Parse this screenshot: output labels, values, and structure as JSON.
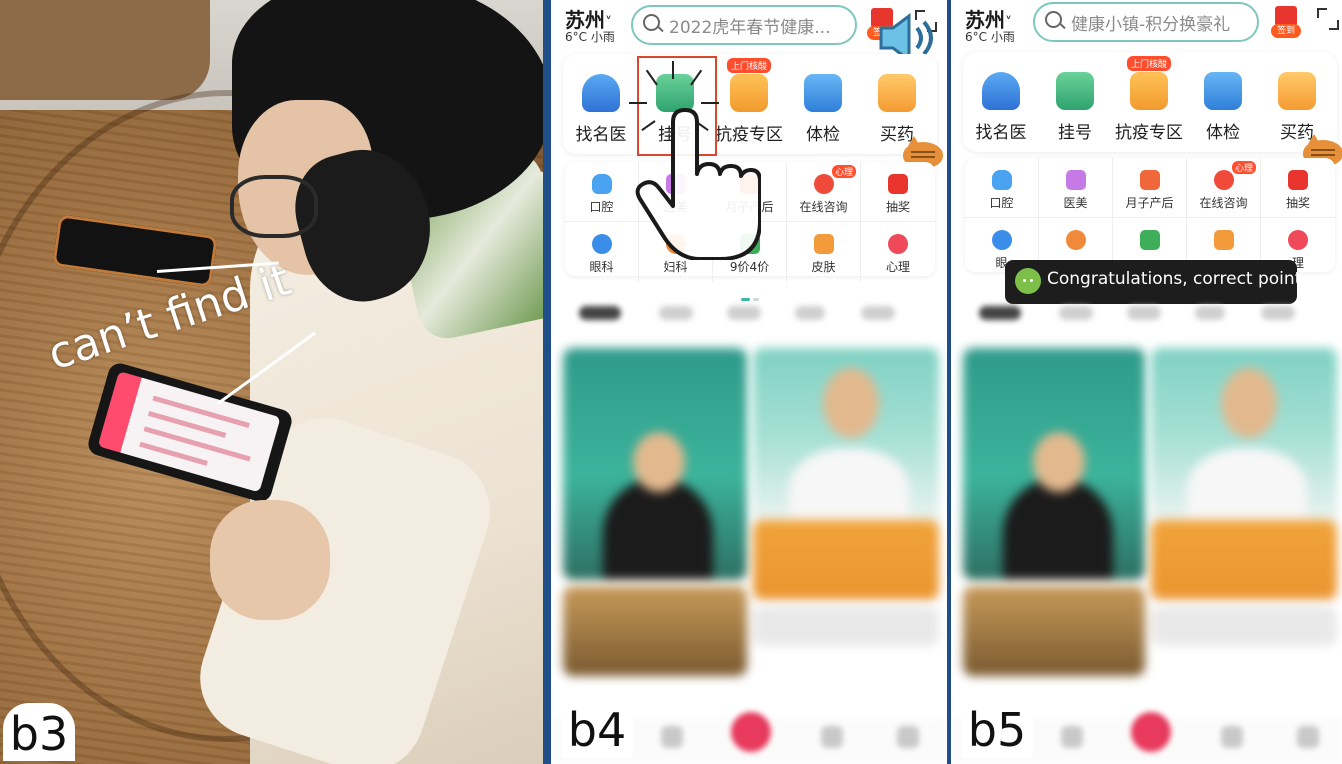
{
  "panels": {
    "b3": {
      "label": "b3",
      "annotation": "can’t find it"
    },
    "b4": {
      "label": "b4",
      "app": {
        "city": "苏州",
        "weather": "6°C 小雨",
        "search_placeholder": "2022虎年春节健康...",
        "checkin_tag": "签到",
        "main_services": [
          {
            "label": "找名医",
            "tag": ""
          },
          {
            "label": "挂号",
            "tag": ""
          },
          {
            "label": "抗疫专区",
            "tag": "上门核酸"
          },
          {
            "label": "体检",
            "tag": ""
          },
          {
            "label": "买药",
            "tag": ""
          }
        ],
        "sub_services": [
          {
            "label": "口腔",
            "tag": ""
          },
          {
            "label": "医美",
            "tag": ""
          },
          {
            "label": "月子产后",
            "tag": ""
          },
          {
            "label": "在线咨询",
            "tag": "心理"
          },
          {
            "label": "抽奖",
            "tag": ""
          },
          {
            "label": "眼科",
            "tag": ""
          },
          {
            "label": "妇科",
            "tag": ""
          },
          {
            "label": "9价4价",
            "tag": ""
          },
          {
            "label": "皮肤",
            "tag": ""
          },
          {
            "label": "心理",
            "tag": ""
          }
        ]
      }
    },
    "b5": {
      "label": "b5",
      "app": {
        "city": "苏州",
        "weather": "6°C 小雨",
        "search_placeholder": "健康小镇-积分换豪礼",
        "checkin_tag": "签到",
        "main_services": [
          {
            "label": "找名医",
            "tag": ""
          },
          {
            "label": "挂号",
            "tag": ""
          },
          {
            "label": "抗疫专区",
            "tag": "上门核酸"
          },
          {
            "label": "体检",
            "tag": ""
          },
          {
            "label": "买药",
            "tag": ""
          }
        ],
        "sub_services": [
          {
            "label": "口腔",
            "tag": ""
          },
          {
            "label": "医美",
            "tag": ""
          },
          {
            "label": "月子产后",
            "tag": ""
          },
          {
            "label": "在线咨询",
            "tag": "心理"
          },
          {
            "label": "抽奖",
            "tag": ""
          },
          {
            "label": "眼",
            "tag": ""
          },
          {
            "label": "",
            "tag": ""
          },
          {
            "label": "",
            "tag": ""
          },
          {
            "label": "",
            "tag": ""
          },
          {
            "label": "理",
            "tag": ""
          }
        ],
        "toast": "Congratulations, correct point"
      }
    }
  },
  "colors": {
    "accent_teal": "#3cb7a6",
    "tag_red": "#ff4d2e",
    "tap_box": "#d9472c",
    "divider": "#1f4f86"
  },
  "icons": {
    "main": [
      "doctor-icon",
      "register-icon",
      "covid-zone-icon",
      "checkup-icon",
      "medicine-box-icon"
    ],
    "sub": [
      "tooth-icon",
      "butterfly-icon",
      "postpartum-icon",
      "consult-icon",
      "lottery-icon",
      "eye-icon",
      "gynecology-icon",
      "vaccine-icon",
      "hand-skin-icon",
      "heart-icon"
    ]
  }
}
